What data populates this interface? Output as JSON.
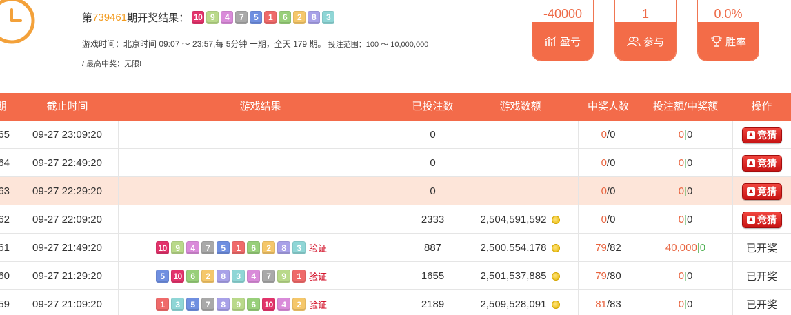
{
  "header": {
    "title_prefix": "第",
    "period_number": "739461",
    "title_suffix": "期开奖结果：",
    "latest_balls": [
      "10",
      "9",
      "4",
      "7",
      "5",
      "1",
      "6",
      "2",
      "8",
      "3"
    ],
    "info_line1": "游戏时间：北京时间 09:07 ～ 23:57,每 5分钟 一期，全天 179 期。",
    "info_range": "投注范围：100 ～ 10,000,000",
    "info_line2": "/ 最高中奖：无限!"
  },
  "stats": [
    {
      "value": "-40000",
      "label": "盈亏",
      "icon": "chart-icon"
    },
    {
      "value": "1",
      "label": "参与",
      "icon": "users-icon"
    },
    {
      "value": "0.0%",
      "label": "胜率",
      "icon": "trophy-icon"
    }
  ],
  "table": {
    "headers": [
      "期",
      "截止时间",
      "游戏结果",
      "已投注数",
      "游戏数额",
      "中奖人数",
      "投注额/中奖额",
      "操作"
    ],
    "verify_label": "验证",
    "guess_label": "竞猜",
    "opened_label": "已开奖",
    "rows": [
      {
        "period": "65",
        "time": "09-27 23:09:20",
        "balls": [],
        "bets": "0",
        "amount": "",
        "win_a": "0",
        "win_b": "0",
        "bet_a": "0",
        "bet_b": "0",
        "action": "guess"
      },
      {
        "period": "64",
        "time": "09-27 22:49:20",
        "balls": [],
        "bets": "0",
        "amount": "",
        "win_a": "0",
        "win_b": "0",
        "bet_a": "0",
        "bet_b": "0",
        "action": "guess"
      },
      {
        "period": "63",
        "time": "09-27 22:29:20",
        "balls": [],
        "bets": "0",
        "amount": "",
        "win_a": "0",
        "win_b": "0",
        "bet_a": "0",
        "bet_b": "0",
        "action": "guess",
        "highlight": true
      },
      {
        "period": "62",
        "time": "09-27 22:09:20",
        "balls": [],
        "bets": "2333",
        "amount": "2,504,591,592",
        "win_a": "0",
        "win_b": "0",
        "bet_a": "0",
        "bet_b": "0",
        "action": "guess"
      },
      {
        "period": "61",
        "time": "09-27 21:49:20",
        "balls": [
          "10",
          "9",
          "4",
          "7",
          "5",
          "1",
          "6",
          "2",
          "8",
          "3"
        ],
        "bets": "887",
        "amount": "2,500,554,178",
        "win_a": "79",
        "win_b": "82",
        "bet_a": "40,000",
        "bet_b": "0",
        "action": "opened"
      },
      {
        "period": "60",
        "time": "09-27 21:29:20",
        "balls": [
          "5",
          "10",
          "6",
          "2",
          "8",
          "3",
          "4",
          "7",
          "9",
          "1"
        ],
        "bets": "1655",
        "amount": "2,501,537,885",
        "win_a": "79",
        "win_b": "80",
        "bet_a": "0",
        "bet_b": "0",
        "action": "opened"
      },
      {
        "period": "59",
        "time": "09-27 21:09:20",
        "balls": [
          "1",
          "3",
          "5",
          "7",
          "8",
          "9",
          "6",
          "10",
          "4",
          "2"
        ],
        "bets": "2189",
        "amount": "2,509,528,091",
        "win_a": "81",
        "win_b": "83",
        "bet_a": "0",
        "bet_b": "0",
        "action": "opened"
      }
    ]
  },
  "ball_colors": {
    "1": "#ef6a6a",
    "2": "#f5c76a",
    "3": "#8fd6d6",
    "4": "#d98bd9",
    "5": "#6f8fe0",
    "6": "#98cf7a",
    "7": "#a9a9a9",
    "8": "#a8a1e8",
    "9": "#b9d98a",
    "10": "#e2336b"
  }
}
